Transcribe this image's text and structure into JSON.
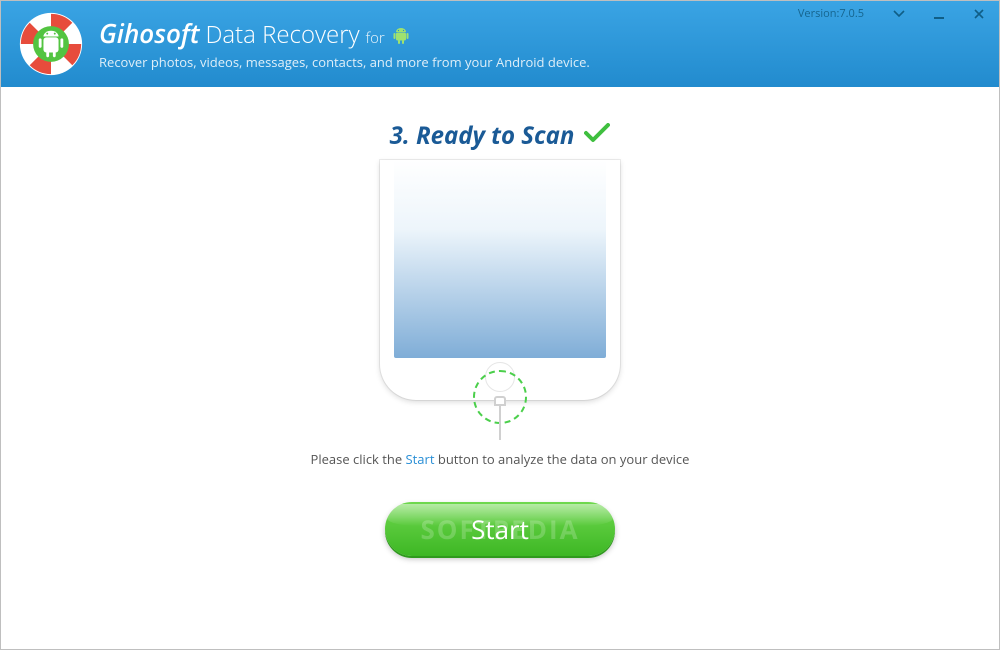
{
  "header": {
    "brand": "Gihosoft",
    "product": "Data Recovery",
    "for": "for",
    "subtitle": "Recover photos, videos, messages, contacts, and more from your Android device.",
    "version": "Version:7.0.5"
  },
  "main": {
    "step_title": "3. Ready to Scan",
    "hint_pre": "Please click the ",
    "hint_kw": "Start",
    "hint_post": " button to analyze the data on your device",
    "start_label": "Start",
    "watermark": "SOFTPEDIA"
  },
  "icons": {
    "titlebar_android": "android-icon",
    "logo": "lifebuoy-android-icon"
  }
}
